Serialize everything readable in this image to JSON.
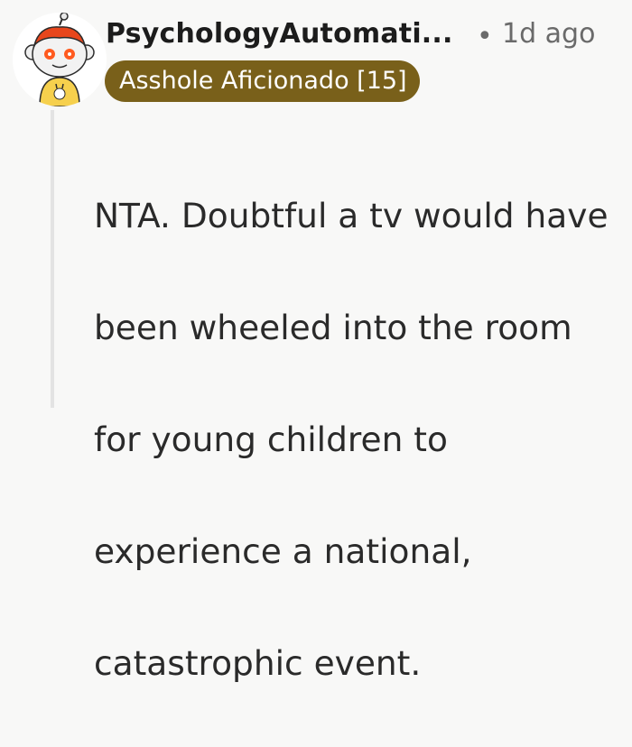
{
  "comment": {
    "author": "PsychologyAutomati...",
    "separator": "•",
    "timestamp": "1d ago",
    "flair": "Asshole Aficionado [15]",
    "flair_color": "#79601a",
    "avatar_icon": "snoo-avatar-icon",
    "body_lines": [
      "NTA. Doubtful a tv would have",
      "been wheeled into the room",
      "for young children to",
      "experience a national,",
      "catastrophic event."
    ]
  }
}
